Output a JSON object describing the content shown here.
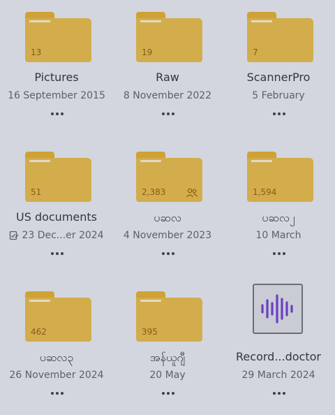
{
  "items": [
    {
      "name": "Pictures",
      "date": "16 September 2015",
      "count": "13",
      "kind": "folder"
    },
    {
      "name": "Raw",
      "date": "8 November 2022",
      "count": "19",
      "kind": "folder"
    },
    {
      "name": "ScannerPro",
      "date": "5 February",
      "count": "7",
      "kind": "folder"
    },
    {
      "name": "US documents",
      "date": "23 Dec...er 2024",
      "count": "51",
      "kind": "folder",
      "date_icon": "edit-check-icon"
    },
    {
      "name": "ပဆလ",
      "date": "4 November 2023",
      "count": "2,383",
      "kind": "folder",
      "badge_icon": "shared-users-icon"
    },
    {
      "name": "ပဆလ၂",
      "date": "10 March",
      "count": "1,594",
      "kind": "folder"
    },
    {
      "name": "ပဆလ၃",
      "date": "26 November 2024",
      "count": "462",
      "kind": "folder"
    },
    {
      "name": "အန်ယူဂျီ",
      "date": "20 May",
      "count": "395",
      "kind": "folder"
    },
    {
      "name": "Record...doctor",
      "date": "29 March 2024",
      "kind": "audio",
      "thumb_icon": "audio-waveform-icon"
    }
  ],
  "colors": {
    "background": "#d3d6de",
    "folder": "#d3ad4c",
    "folder_tab": "#cfa235",
    "count_text": "#8a5a18",
    "waveform": "#6b3fc4"
  }
}
